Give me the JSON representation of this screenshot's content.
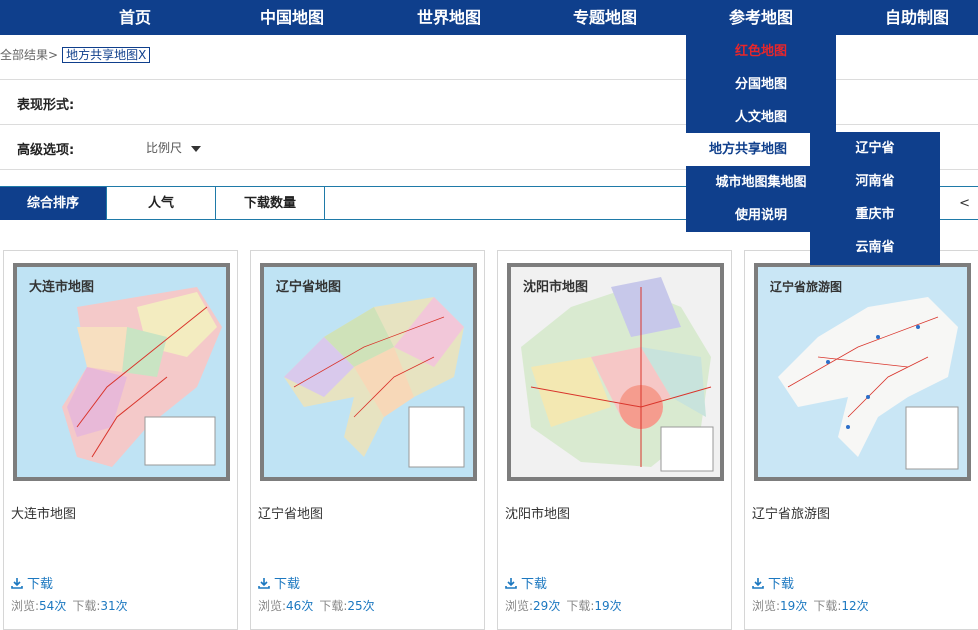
{
  "nav": [
    "首页",
    "中国地图",
    "世界地图",
    "专题地图",
    "参考地图",
    "自助制图"
  ],
  "breadcrumb": {
    "all": "全部结果>",
    "tag": "地方共享地图X"
  },
  "filters": {
    "form_label": "表现形式:",
    "advanced_label": "高级选项:",
    "scale_label": "比例尺"
  },
  "sort": {
    "items": [
      "综合排序",
      "人气",
      "下载数量"
    ],
    "active": "综合排序",
    "page_prev": "<"
  },
  "dropdown": [
    "红色地图",
    "分国地图",
    "人文地图",
    "地方共享地图",
    "城市地图集地图",
    "使用说明"
  ],
  "submenu": [
    "辽宁省",
    "河南省",
    "重庆市",
    "云南省"
  ],
  "cards": [
    {
      "title": "大连市地图",
      "map_label": "大连市地图",
      "download": "下载",
      "views_label": "浏览:",
      "views": "54次",
      "downloads_label": "下载:",
      "downloads": "31次"
    },
    {
      "title": "辽宁省地图",
      "map_label": "辽宁省地图",
      "download": "下载",
      "views_label": "浏览:",
      "views": "46次",
      "downloads_label": "下载:",
      "downloads": "25次"
    },
    {
      "title": "沈阳市地图",
      "map_label": "沈阳市地图",
      "download": "下载",
      "views_label": "浏览:",
      "views": "29次",
      "downloads_label": "下载:",
      "downloads": "19次"
    },
    {
      "title": "辽宁省旅游图",
      "map_label": "辽宁省旅游图",
      "download": "下载",
      "views_label": "浏览:",
      "views": "19次",
      "downloads_label": "下载:",
      "downloads": "12次"
    }
  ],
  "colors": {
    "brand": "#0f3f8c",
    "link": "#1c78c0",
    "highlight": "#e8262b"
  }
}
